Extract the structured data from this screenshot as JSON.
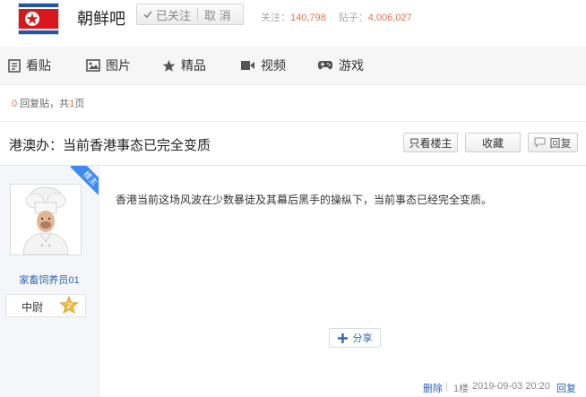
{
  "forum": {
    "name": "朝鲜吧",
    "follow_label": "已关注",
    "unfollow_label": "取 消",
    "members_label": "关注：",
    "members_count": "140,798",
    "posts_label": "贴子：",
    "posts_count": "4,006,027"
  },
  "nav": {
    "items": [
      {
        "label": "看贴",
        "icon": "document-icon"
      },
      {
        "label": "图片",
        "icon": "image-icon"
      },
      {
        "label": "精品",
        "icon": "star-icon"
      },
      {
        "label": "视频",
        "icon": "video-camera-icon"
      },
      {
        "label": "游戏",
        "icon": "gamepad-icon"
      }
    ]
  },
  "pager": {
    "reply_count": "0",
    "reply_label": "回复贴，共",
    "page_count": "1",
    "page_label": "页"
  },
  "thread": {
    "title": "港澳办：当前香港事态已完全变质",
    "only_op_label": "只看楼主",
    "favorite_label": "收藏",
    "reply_label": "回复"
  },
  "post": {
    "op_badge": "楼主",
    "username": "家畜饲养员01",
    "rank": "中尉",
    "level": "7",
    "content": "香港当前这场风波在少数暴徒及其幕后黑手的操纵下，当前事态已经完全变质。",
    "share_label": "分享",
    "delete_label": "删除",
    "floor": "1楼",
    "datetime": "2019-09-03 20:20",
    "reply_label": "回复"
  },
  "colors": {
    "accent_blue": "#2d64b3",
    "badge_blue": "#3d8af2",
    "count_orange": "#e8734a",
    "flag_red": "#d8161b",
    "flag_blue": "#1f57a6"
  }
}
